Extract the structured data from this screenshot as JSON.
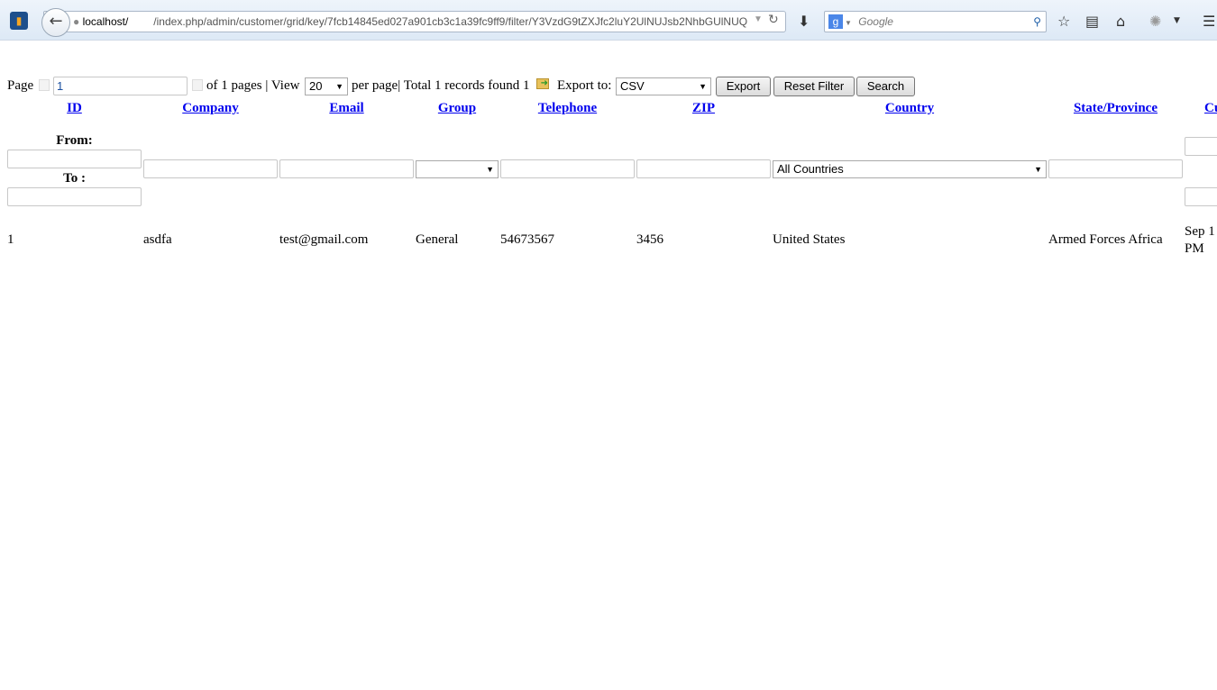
{
  "browser": {
    "url_host": "localhost/",
    "url_path": "/index.php/admin/customer/grid/key/7fcb14845ed027a901cb3c1a39fc9ff9/filter/Y3VzdG9tZXJfc2luY2UlNUJsb2NhbGUlNUQ",
    "search_placeholder": "Google"
  },
  "pager": {
    "page_label": "Page",
    "page_value": "1",
    "of_pages": "of 1 pages | View",
    "view_value": "20",
    "per_page": "per page| Total 1 records found 1",
    "export_to": "Export to:",
    "export_value": "CSV",
    "export_button": "Export",
    "reset_button": "Reset Filter",
    "search_button": "Search"
  },
  "columns": [
    "ID",
    "Company",
    "Email",
    "Group",
    "Telephone",
    "ZIP",
    "Country",
    "State/Province",
    "Cu"
  ],
  "filters": {
    "from_label": "From:",
    "to_label": "To :",
    "country_value": "All Countries"
  },
  "rows": [
    {
      "id": "1",
      "company": "asdfa",
      "email": "test@gmail.com",
      "group": "General",
      "telephone": "54673567",
      "zip": "3456",
      "country": "United States",
      "state": "Armed Forces Africa",
      "since": "Sep 1 PM"
    }
  ]
}
